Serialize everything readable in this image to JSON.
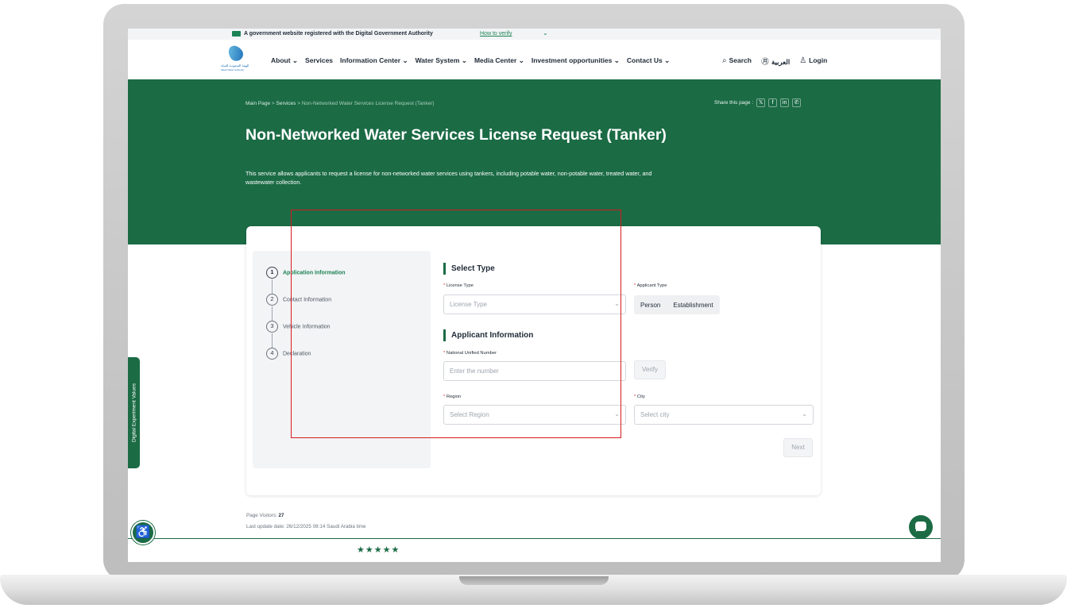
{
  "gov_banner": {
    "text": "A government website registered with the Digital Government Authority",
    "verify_link": "How to verify"
  },
  "header": {
    "logo_alt": "الهيئة السعودية للمياه",
    "logo_sub": "Saudi Water Authority",
    "nav": [
      "About",
      "Services",
      "Information Center",
      "Water System",
      "Media Center",
      "Investment opportunities",
      "Contact Us"
    ],
    "search_label": "Search",
    "language_label": "العربية",
    "login_label": "Login"
  },
  "hero": {
    "breadcrumb": [
      "Main Page",
      "Services",
      "Non-Networked Water Services License Request (Tanker)"
    ],
    "share_label": "Share this page :",
    "share_icons": [
      "x-icon",
      "facebook-icon",
      "linkedin-icon",
      "whatsapp-icon"
    ],
    "title": "Non-Networked Water Services License Request (Tanker)",
    "description": "This service allows applicants to request a license for non-networked water services using tankers, including potable water, non-potable water, treated water, and wastewater collection."
  },
  "steps": [
    {
      "num": "1",
      "label": "Application Information"
    },
    {
      "num": "2",
      "label": "Contact Information"
    },
    {
      "num": "3",
      "label": "Vehicle Information"
    },
    {
      "num": "4",
      "label": "Declaration"
    }
  ],
  "form": {
    "select_type_title": "Select Type",
    "license_type_label": "License Type",
    "license_type_placeholder": "License Type",
    "applicant_type_label": "Applicant Type",
    "applicant_type_options": [
      "Person",
      "Establishment"
    ],
    "applicant_info_title": "Applicant Information",
    "national_number_label": "National Unified Number",
    "national_number_placeholder": "Enter the number",
    "verify_button": "Verify",
    "region_label": "Region",
    "region_placeholder": "Select Region",
    "city_label": "City",
    "city_placeholder": "Select city",
    "next_button": "Next",
    "required_mark": "*"
  },
  "side_tab": "Digital Experiment Values",
  "footer": {
    "visitors_label": "Page Visitors:",
    "visitors_count": "27",
    "last_update": "Last update date: 26/12/2025 08:14 Saudi Arabia time"
  },
  "colors": {
    "brand_green": "#1b6b45",
    "highlight_red": "#d71920"
  }
}
